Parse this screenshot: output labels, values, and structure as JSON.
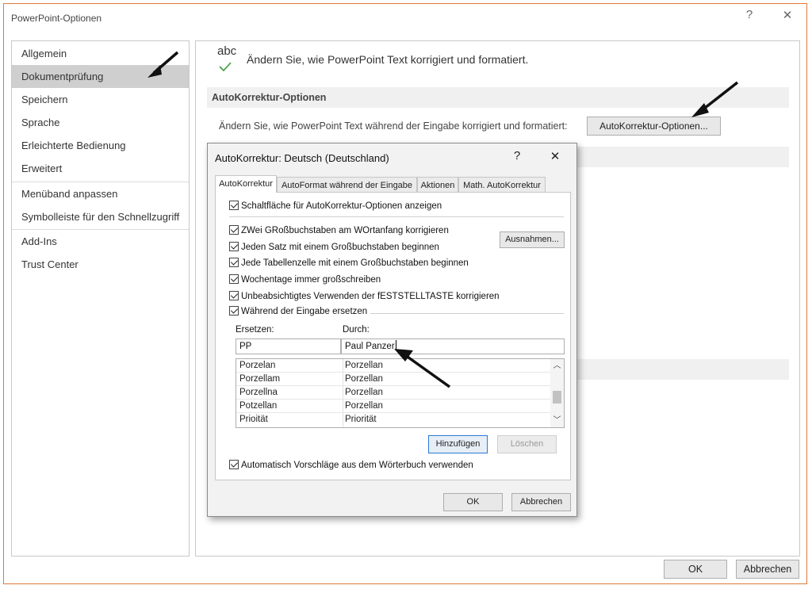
{
  "window": {
    "title": "PowerPoint-Optionen",
    "help_glyph": "?",
    "close_glyph": "✕"
  },
  "sidebar": {
    "items": [
      {
        "label": "Allgemein"
      },
      {
        "label": "Dokumentprüfung",
        "selected": true
      },
      {
        "label": "Speichern"
      },
      {
        "label": "Sprache"
      },
      {
        "label": "Erleichterte Bedienung"
      },
      {
        "label": "Erweitert"
      },
      {
        "label": "Menüband anpassen"
      },
      {
        "label": "Symbolleiste für den Schnellzugriff"
      },
      {
        "label": "Add-Ins"
      },
      {
        "label": "Trust Center"
      }
    ]
  },
  "main": {
    "abc": "abc",
    "intro": "Ändern Sie, wie PowerPoint Text korrigiert und formatiert.",
    "section_title": "AutoKorrektur-Optionen",
    "section_desc": "Ändern Sie, wie PowerPoint Text während der Eingabe korrigiert und formatiert:",
    "autocorrect_button": "AutoKorrektur-Optionen..."
  },
  "footer": {
    "ok": "OK",
    "cancel": "Abbrechen"
  },
  "dialog": {
    "title": "AutoKorrektur: Deutsch (Deutschland)",
    "help_glyph": "?",
    "close_glyph": "✕",
    "tabs": [
      {
        "label": "AutoKorrektur",
        "active": true
      },
      {
        "label": "AutoFormat während der Eingabe"
      },
      {
        "label": "Aktionen"
      },
      {
        "label": "Math. AutoKorrektur"
      }
    ],
    "checks": {
      "show_buttons": "Schaltfläche für AutoKorrektur-Optionen anzeigen",
      "two_caps": "ZWei GRoßbuchstaben am WOrtanfang korrigieren",
      "sentence": "Jeden Satz mit einem Großbuchstaben beginnen",
      "table_cell": "Jede Tabellenzelle mit einem Großbuchstaben beginnen",
      "weekdays": "Wochentage immer großschreiben",
      "capslock": "Unbeabsichtigtes Verwenden der fESTSTELLTASTE korrigieren",
      "replace": "Während der Eingabe ersetzen",
      "suggestions": "Automatisch Vorschläge aus dem Wörterbuch verwenden"
    },
    "exceptions_button": "Ausnahmen...",
    "replace_label": "Ersetzen:",
    "with_label": "Durch:",
    "replace_value": "PP",
    "with_value": "Paul Panzer",
    "list_rows": [
      {
        "from": "Porzelan",
        "to": "Porzellan"
      },
      {
        "from": "Porzellam",
        "to": "Porzellan"
      },
      {
        "from": "Porzellna",
        "to": "Porzellan"
      },
      {
        "from": "Potzellan",
        "to": "Porzellan"
      },
      {
        "from": "Prioität",
        "to": "Priorität"
      }
    ],
    "add_button": "Hinzufügen",
    "delete_button": "Löschen",
    "ok": "OK",
    "cancel": "Abbrechen"
  },
  "colors": {
    "frame": "#e07a3a",
    "selected": "#cfcfcf",
    "accent": "#2a7ad5",
    "check": "#3a9a3a"
  }
}
